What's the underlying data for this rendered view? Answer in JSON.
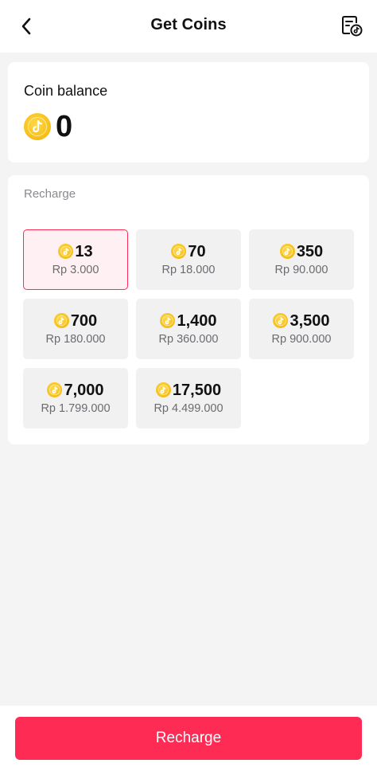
{
  "header": {
    "title": "Get Coins",
    "back_icon": "chevron-left-icon",
    "history_icon": "transaction-history-icon"
  },
  "balance": {
    "label": "Coin balance",
    "value": "0",
    "icon": "coin-icon"
  },
  "recharge_section": {
    "label": "Recharge",
    "options": [
      {
        "coins": "13",
        "price": "Rp 3.000",
        "selected": true
      },
      {
        "coins": "70",
        "price": "Rp 18.000",
        "selected": false
      },
      {
        "coins": "350",
        "price": "Rp 90.000",
        "selected": false
      },
      {
        "coins": "700",
        "price": "Rp 180.000",
        "selected": false
      },
      {
        "coins": "1,400",
        "price": "Rp 360.000",
        "selected": false
      },
      {
        "coins": "3,500",
        "price": "Rp 900.000",
        "selected": false
      },
      {
        "coins": "7,000",
        "price": "Rp 1.799.000",
        "selected": false
      },
      {
        "coins": "17,500",
        "price": "Rp 4.499.000",
        "selected": false
      }
    ]
  },
  "footer": {
    "recharge_button": "Recharge"
  },
  "colors": {
    "accent": "#fe2c55",
    "selected_bg": "#fff1f3",
    "coin": "#f7c21b",
    "page_bg": "#f4f4f5"
  }
}
